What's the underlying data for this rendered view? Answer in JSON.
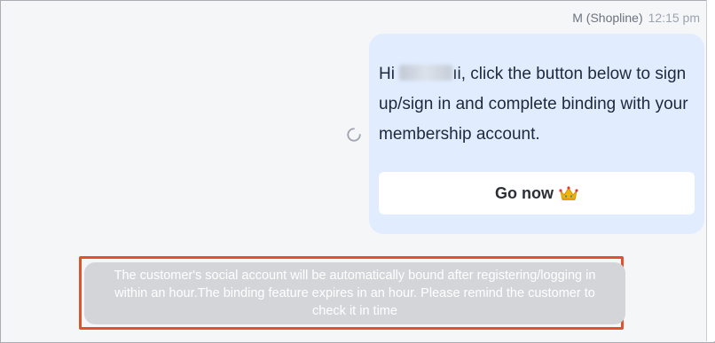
{
  "header": {
    "sender": "M (Shopline)",
    "time": "12:15 pm"
  },
  "message": {
    "greeting": "Hi",
    "name_suffix": "ıi",
    "text": ", click the button below to sign up/sign in and complete binding with your membership account.",
    "button_label": "Go now",
    "button_icon": "crown-icon"
  },
  "system_notice": {
    "text": "The customer's social account will be automatically bound after registering/logging in within an hour.The binding feature expires in an hour. Please remind the customer to check it in time",
    "highlight_color": "#e2512d"
  },
  "colors": {
    "bubble": "#e1edff",
    "notice_bg": "#d3d5d8",
    "background": "#f5f6f8"
  }
}
